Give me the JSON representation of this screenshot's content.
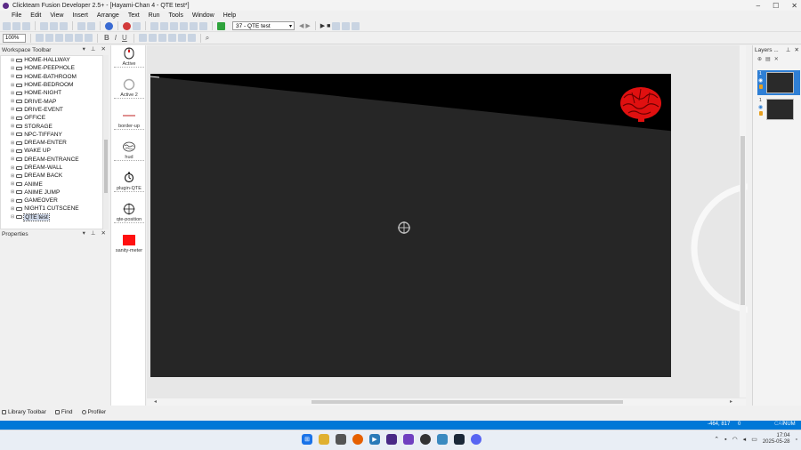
{
  "window": {
    "title": "Clickteam Fusion Developer 2.5+ - [Hayami-Chan 4 - QTE test*]",
    "controls": [
      "–",
      "☐",
      "✕"
    ]
  },
  "menu": [
    "File",
    "Edit",
    "View",
    "Insert",
    "Arrange",
    "Text",
    "Run",
    "Tools",
    "Window",
    "Help"
  ],
  "toolbar": {
    "frame_select": "37 - QTE test",
    "zoom": "100%",
    "bold": "B",
    "italic": "I",
    "underline": "U"
  },
  "workspace": {
    "title": "Workspace Toolbar",
    "items": [
      "HOME-HALLWAY",
      "HOME-PEEPHOLE",
      "HOME-BATHROOM",
      "HOME-BEDROOM",
      "HOME-NIGHT",
      "DRIVE-MAP",
      "DRIVE-EVENT",
      "OFFICE",
      "STORAGE",
      "NPC-TIFFANY",
      "DREAM-ENTER",
      "WAKE UP",
      "DREAM-ENTRANCE",
      "DREAM-WALL",
      "DREAM BACK",
      "ANIME",
      "ANIME JUMP",
      "GAMEOVER",
      "NIGHT1 CUTSCENE",
      "QTE test"
    ],
    "selected": "QTE test"
  },
  "properties": {
    "title": "Properties"
  },
  "objects": [
    {
      "name": "Active",
      "icon": "mouse-icon"
    },
    {
      "name": "Active 2",
      "icon": "ring-icon"
    },
    {
      "name": "border-up",
      "icon": "line-icon"
    },
    {
      "name": "hud",
      "icon": "brain-icon"
    },
    {
      "name": "plugin-QTE",
      "icon": "gear-icon"
    },
    {
      "name": "qte-position",
      "icon": "crosshair-icon"
    },
    {
      "name": "sanity-meter",
      "icon": "red-rect-icon"
    }
  ],
  "layers": {
    "title": "Layers ...",
    "rows": [
      "1",
      "1"
    ]
  },
  "bottom_tabs": [
    "Library Toolbar",
    "Find",
    "Profiler"
  ],
  "status": {
    "coords": "-464, 817",
    "zero": "0",
    "caps": "CAP",
    "num": "NUM"
  },
  "taskbar": {
    "time": "17:04",
    "date": "2025-05-28"
  },
  "colors": {
    "accent": "#0078d7",
    "frame_background": "#262626",
    "hud_band": "#000000",
    "brain": "#e01010"
  }
}
